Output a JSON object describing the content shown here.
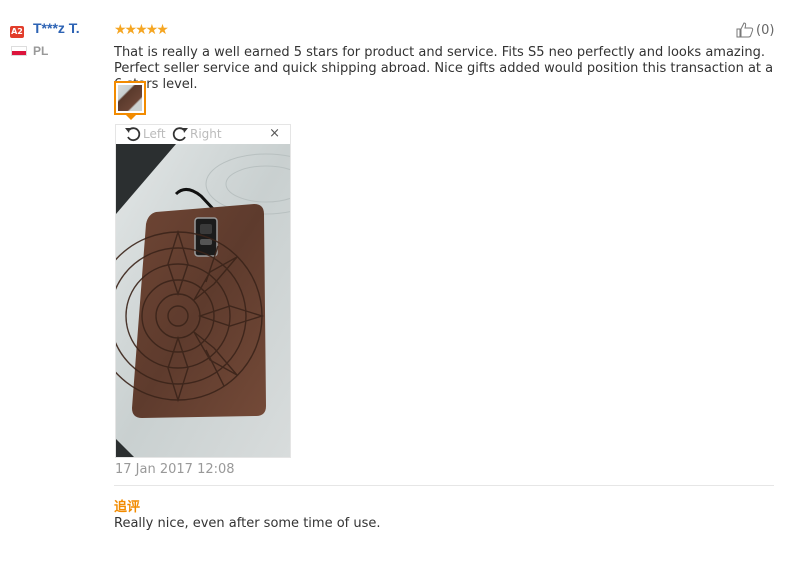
{
  "reviewer": {
    "level_badge": "A2",
    "name": "T***z T.",
    "country": "PL",
    "flag_colors": [
      "#ffffff",
      "#dc143c"
    ]
  },
  "review": {
    "rating": 5,
    "stars_text": "★★★★★",
    "star_color": "#f5a623",
    "helpful_count": "(0)",
    "text": "That is really a well earned 5 stars for product and service. Fits S5 neo perfectly and looks amazing. Perfect seller service and quick shipping abroad. Nice gifts added would position this transaction at a 6 stars level.",
    "date": "17 Jan 2017 12:08"
  },
  "image_viewer": {
    "rotate_left_label": "Left",
    "rotate_right_label": "Right",
    "close_label": "×",
    "image_icon": "phone-case-photo"
  },
  "followup": {
    "label": "追评",
    "text": "Really nice, even after some time of use."
  },
  "colors": {
    "accent": "#f28b00",
    "link": "#2d63b4",
    "badge": "#e23d2b"
  }
}
